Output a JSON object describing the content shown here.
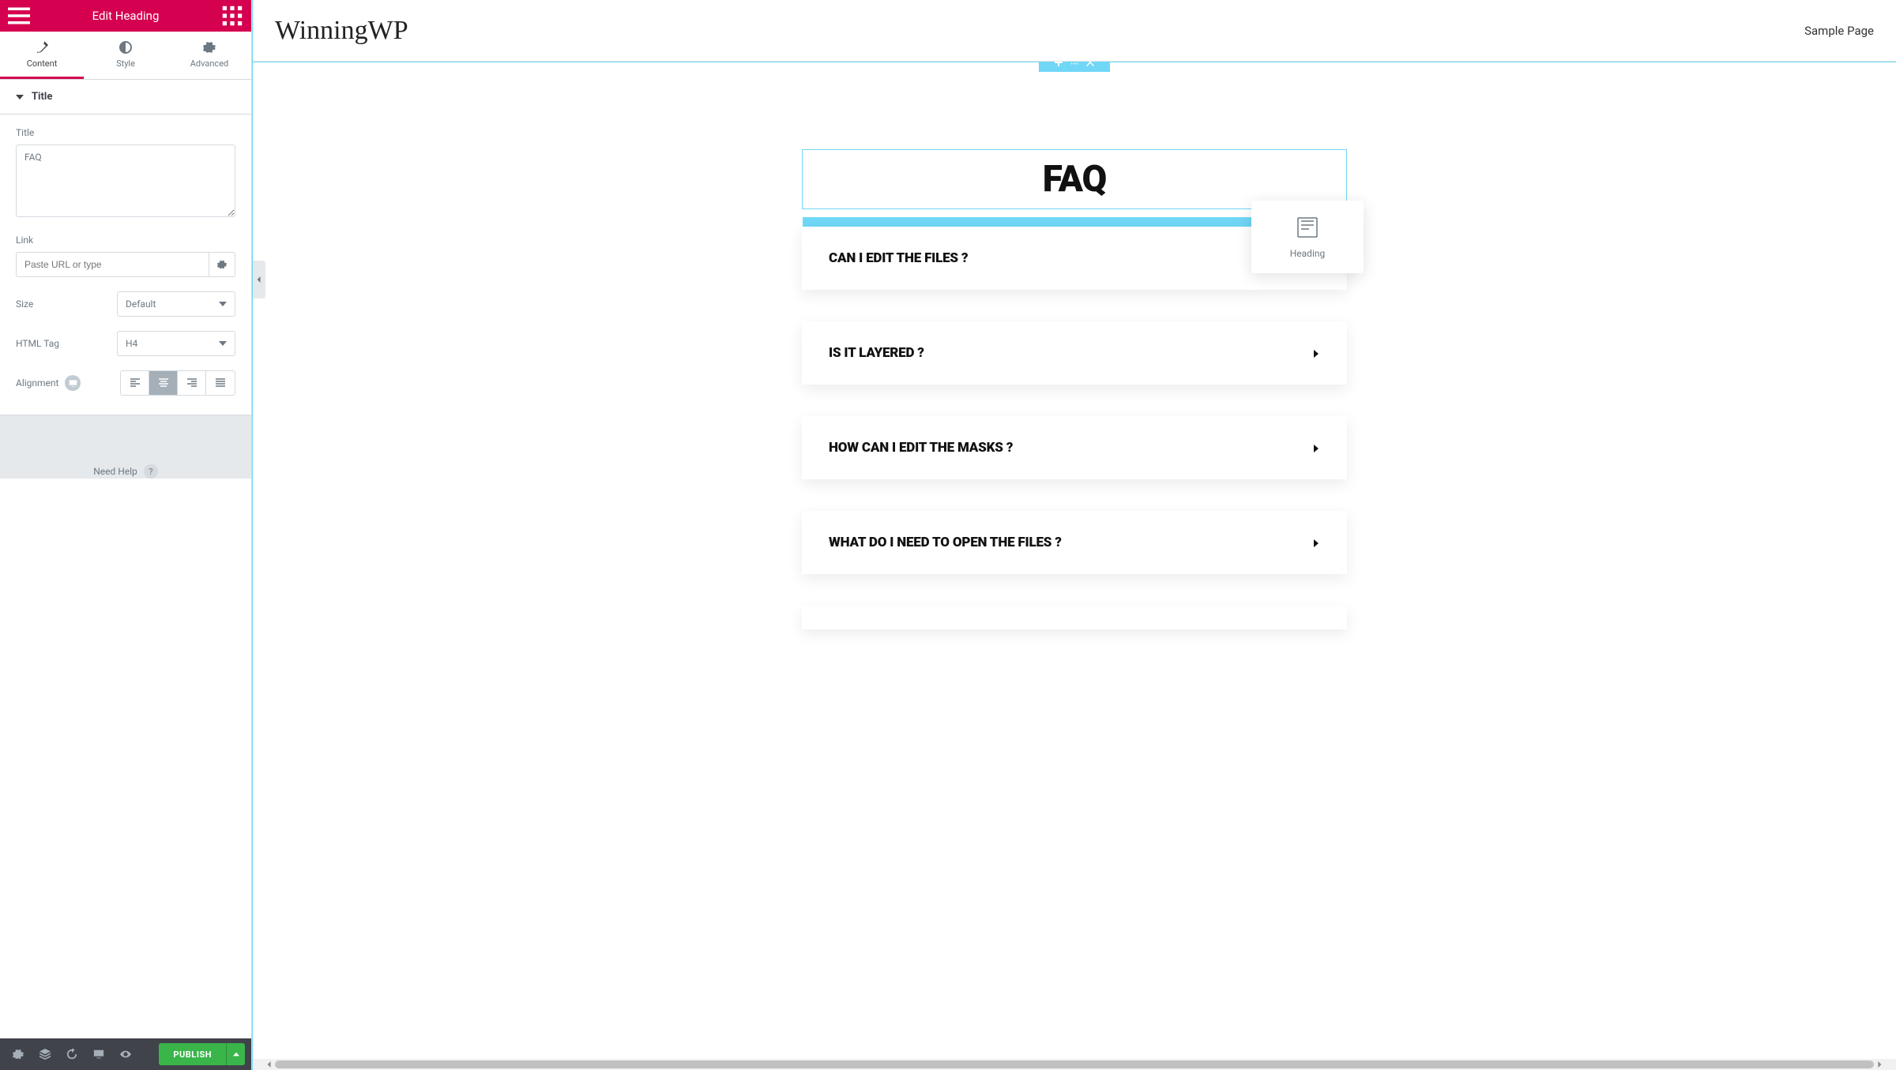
{
  "panel": {
    "header_title": "Edit Heading",
    "tabs": {
      "content": "Content",
      "style": "Style",
      "advanced": "Advanced"
    },
    "section_title": "Title",
    "controls": {
      "title_label": "Title",
      "title_value": "FAQ",
      "link_label": "Link",
      "link_placeholder": "Paste URL or type",
      "size_label": "Size",
      "size_value": "Default",
      "html_tag_label": "HTML Tag",
      "html_tag_value": "H4",
      "alignment_label": "Alignment",
      "alignment_active_index": 1
    },
    "need_help": "Need Help"
  },
  "bottom_bar": {
    "publish": "PUBLISH"
  },
  "preview": {
    "site_title": "WinningWP",
    "nav_link": "Sample Page",
    "faq_heading": "FAQ",
    "drag_widget_label": "Heading",
    "accordion": [
      "CAN I EDIT THE FILES ?",
      "IS IT LAYERED ?",
      "HOW CAN I EDIT THE MASKS ?",
      "WHAT DO I NEED TO OPEN THE FILES ?"
    ]
  }
}
